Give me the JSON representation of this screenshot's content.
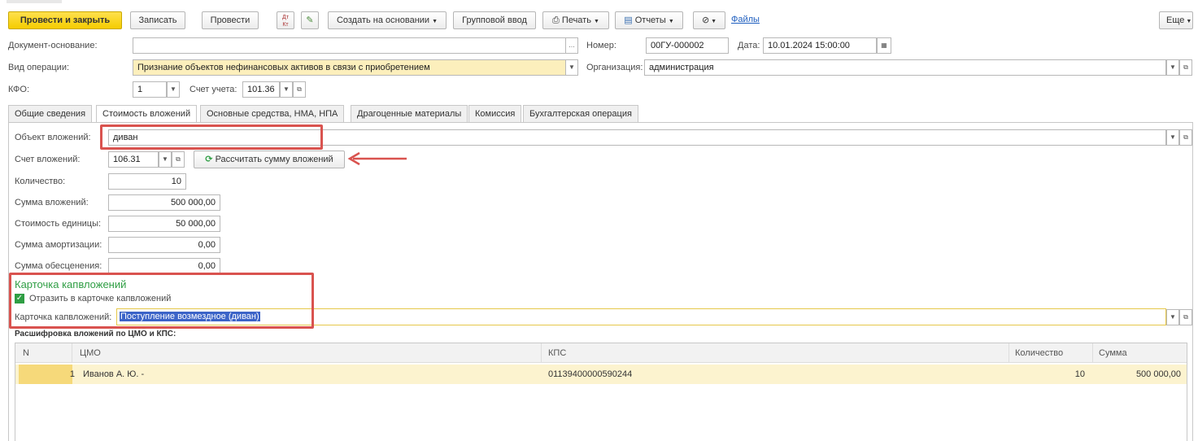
{
  "toolbar": {
    "post_close": "Провести и закрыть",
    "save": "Записать",
    "post": "Провести",
    "dt_kt": "Дт Кт",
    "create_based": "Создать на основании",
    "group_input": "Групповой ввод",
    "print": "Печать",
    "reports": "Отчеты",
    "files": "Файлы",
    "more": "Еще"
  },
  "header": {
    "base_doc_label": "Документ-основание:",
    "base_doc_value": "",
    "number_label": "Номер:",
    "number_value": "00ГУ-000002",
    "date_label": "Дата:",
    "date_value": "10.01.2024 15:00:00",
    "operation_label": "Вид операции:",
    "operation_value": "Признание объектов нефинансовых активов в связи с приобретением",
    "org_label": "Организация:",
    "org_value": "администрация",
    "kfo_label": "КФО:",
    "kfo_value": "1",
    "account_label": "Счет учета:",
    "account_value": "101.36"
  },
  "tabs": [
    {
      "label": "Общие сведения"
    },
    {
      "label": "Стоимость вложений"
    },
    {
      "label": "Основные средства, НМА, НПА"
    },
    {
      "label": "Драгоценные материалы"
    },
    {
      "label": "Комиссия"
    },
    {
      "label": "Бухгалтерская операция"
    }
  ],
  "form": {
    "object_label": "Объект вложений:",
    "object_value": "диван",
    "invest_account_label": "Счет вложений:",
    "invest_account_value": "106.31",
    "calc_button": "Рассчитать сумму вложений",
    "qty_label": "Количество:",
    "qty_value": "10",
    "sum_label": "Сумма вложений:",
    "sum_value": "500 000,00",
    "unit_cost_label": "Стоимость единицы:",
    "unit_cost_value": "50 000,00",
    "amort_label": "Сумма амортизации:",
    "amort_value": "0,00",
    "impair_label": "Сумма обесценения:",
    "impair_value": "0,00"
  },
  "card": {
    "title": "Карточка капвложений",
    "checkbox_label": "Отразить в карточке капвложений",
    "field_label": "Карточка капвложений:",
    "field_value": "Поступление возмездное (диван)"
  },
  "table": {
    "title": "Расшифровка вложений по ЦМО и КПС:",
    "columns": [
      "N",
      "ЦМО",
      "КПС",
      "Количество",
      "Сумма"
    ],
    "rows": [
      {
        "n": "1",
        "cmo": "Иванов А. Ю. -",
        "kps": "01139400000590244",
        "qty": "10",
        "sum": "500 000,00"
      }
    ]
  },
  "colors": {
    "accent_yellow": "#f5cc00",
    "annotation_red": "#d9534f",
    "section_green": "#2f9e44",
    "selected_row": "#fcf3cf"
  }
}
